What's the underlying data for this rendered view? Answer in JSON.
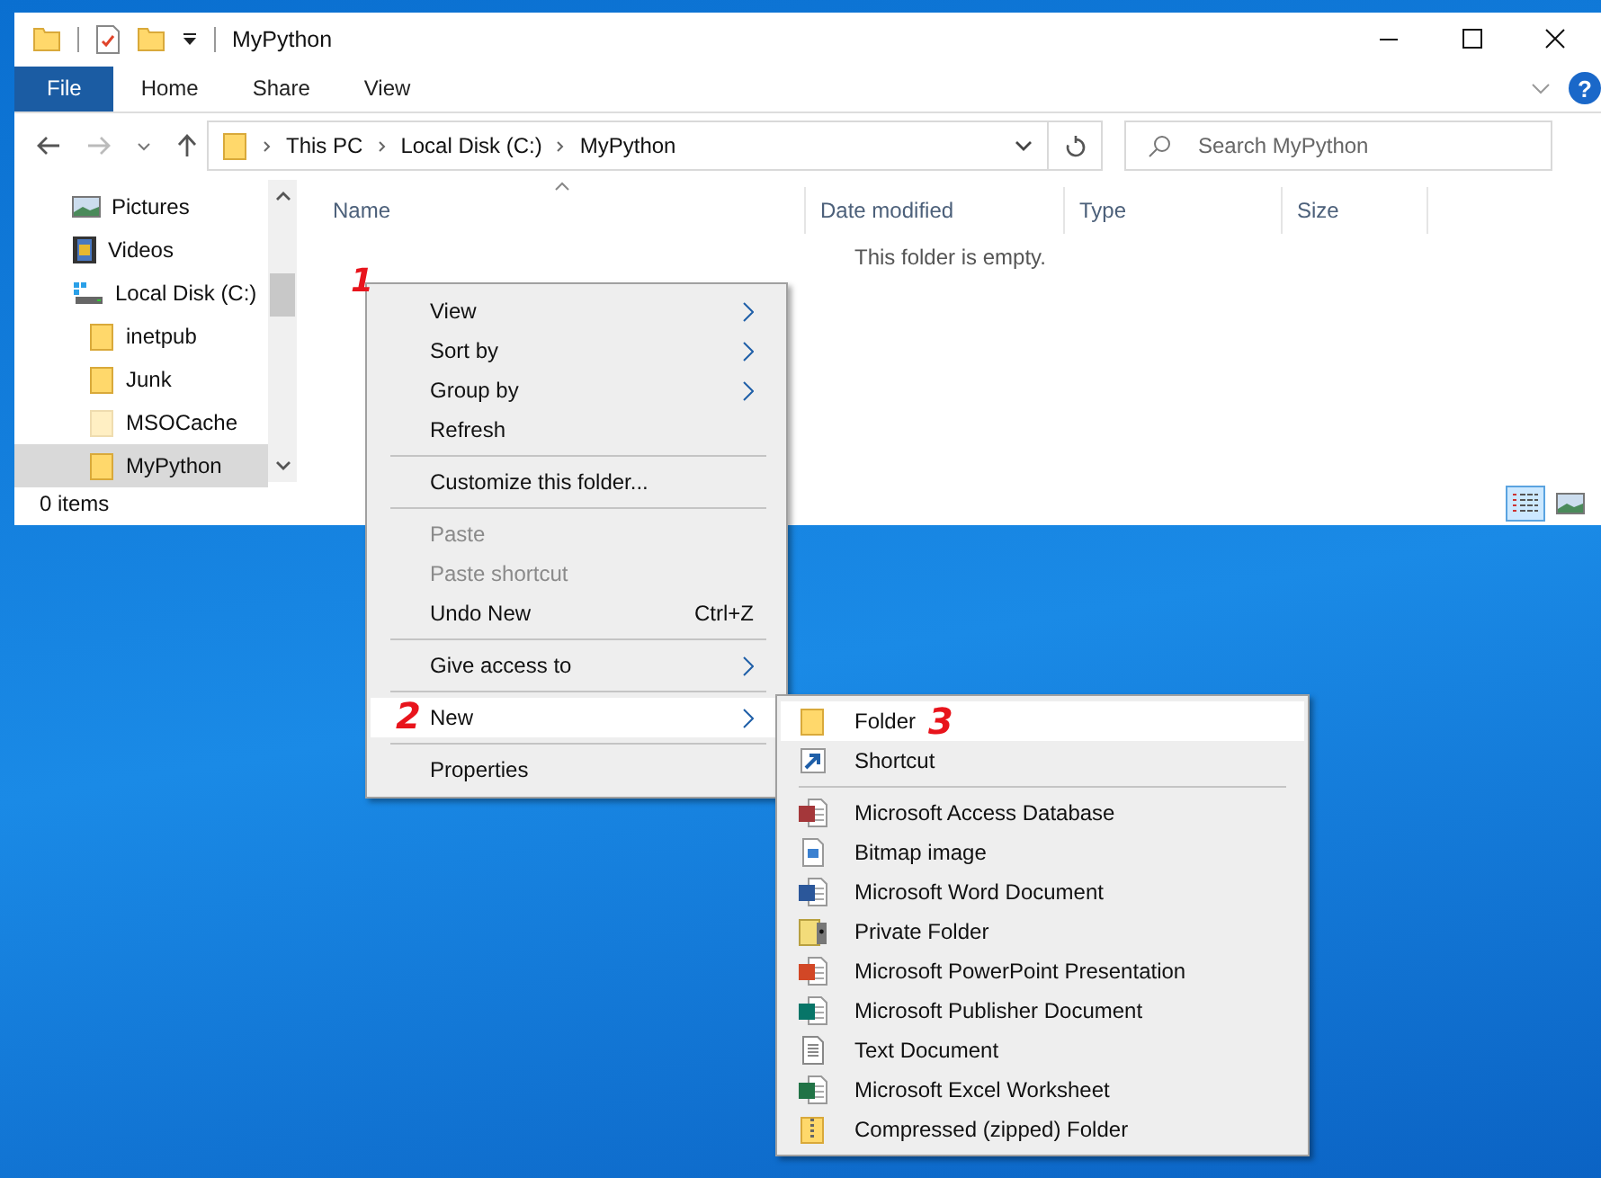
{
  "window": {
    "title": "MyPython"
  },
  "ribbon": {
    "tabs": [
      {
        "label": "File",
        "kind": "file",
        "selected": false
      },
      {
        "label": "Home",
        "kind": "tab",
        "selected": false
      },
      {
        "label": "Share",
        "kind": "tab",
        "selected": false
      },
      {
        "label": "View",
        "kind": "tab",
        "selected": false
      }
    ],
    "help": "?"
  },
  "address_bar": {
    "path": [
      "This PC",
      "Local Disk (C:)",
      "MyPython"
    ]
  },
  "search": {
    "placeholder": "Search MyPython"
  },
  "nav_pane": {
    "items": [
      {
        "label": "Pictures",
        "kind": "pictures",
        "selected": false
      },
      {
        "label": "Videos",
        "kind": "videos",
        "selected": false
      },
      {
        "label": "Local Disk (C:)",
        "kind": "drive",
        "selected": false,
        "children": [
          {
            "label": "inetpub",
            "kind": "folder",
            "selected": false,
            "hidden": false
          },
          {
            "label": "Junk",
            "kind": "folder",
            "selected": false,
            "hidden": false
          },
          {
            "label": "MSOCache",
            "kind": "folder",
            "selected": false,
            "hidden": true
          },
          {
            "label": "MyPython",
            "kind": "folder",
            "selected": true,
            "hidden": false
          }
        ]
      }
    ]
  },
  "file_list": {
    "columns": [
      {
        "label": "Name",
        "sorted": true
      },
      {
        "label": "Date modified",
        "sorted": false
      },
      {
        "label": "Type",
        "sorted": false
      },
      {
        "label": "Size",
        "sorted": false
      }
    ],
    "empty_message": "This folder is empty.",
    "annotation": "1"
  },
  "status_bar": {
    "item_count": "0 items",
    "views": [
      {
        "kind": "details",
        "selected": true
      },
      {
        "kind": "large-icons",
        "selected": false
      }
    ]
  },
  "context_menu": {
    "items": [
      {
        "kind": "item",
        "label": "View",
        "submenu": true,
        "disabled": false,
        "selected": false
      },
      {
        "kind": "item",
        "label": "Sort by",
        "submenu": true,
        "disabled": false,
        "selected": false
      },
      {
        "kind": "item",
        "label": "Group by",
        "submenu": true,
        "disabled": false,
        "selected": false
      },
      {
        "kind": "item",
        "label": "Refresh",
        "submenu": false,
        "disabled": false,
        "selected": false
      },
      {
        "kind": "separator"
      },
      {
        "kind": "item",
        "label": "Customize this folder...",
        "submenu": false,
        "disabled": false,
        "selected": false
      },
      {
        "kind": "separator"
      },
      {
        "kind": "item",
        "label": "Paste",
        "submenu": false,
        "disabled": true,
        "selected": false
      },
      {
        "kind": "item",
        "label": "Paste shortcut",
        "submenu": false,
        "disabled": true,
        "selected": false
      },
      {
        "kind": "item",
        "label": "Undo New",
        "shortcut": "Ctrl+Z",
        "submenu": false,
        "disabled": false,
        "selected": false
      },
      {
        "kind": "separator"
      },
      {
        "kind": "item",
        "label": "Give access to",
        "submenu": true,
        "disabled": false,
        "selected": false
      },
      {
        "kind": "separator"
      },
      {
        "kind": "item",
        "label": "New",
        "submenu": true,
        "disabled": false,
        "selected": true,
        "annotation": "2"
      },
      {
        "kind": "separator"
      },
      {
        "kind": "item",
        "label": "Properties",
        "submenu": false,
        "disabled": false,
        "selected": false
      }
    ]
  },
  "new_submenu": {
    "items": [
      {
        "kind": "folder",
        "label": "Folder",
        "selected": true,
        "annotation": "3"
      },
      {
        "kind": "shortcut",
        "label": "Shortcut",
        "selected": false
      },
      {
        "kind": "separator"
      },
      {
        "kind": "access",
        "label": "Microsoft Access Database",
        "selected": false
      },
      {
        "kind": "bitmap",
        "label": "Bitmap image",
        "selected": false
      },
      {
        "kind": "word",
        "label": "Microsoft Word Document",
        "selected": false
      },
      {
        "kind": "private",
        "label": "Private Folder",
        "selected": false
      },
      {
        "kind": "powerpoint",
        "label": "Microsoft PowerPoint Presentation",
        "selected": false
      },
      {
        "kind": "publisher",
        "label": "Microsoft Publisher Document",
        "selected": false
      },
      {
        "kind": "text",
        "label": "Text Document",
        "selected": false
      },
      {
        "kind": "excel",
        "label": "Microsoft Excel Worksheet",
        "selected": false
      },
      {
        "kind": "zip",
        "label": "Compressed (zipped) Folder",
        "selected": false
      }
    ]
  }
}
